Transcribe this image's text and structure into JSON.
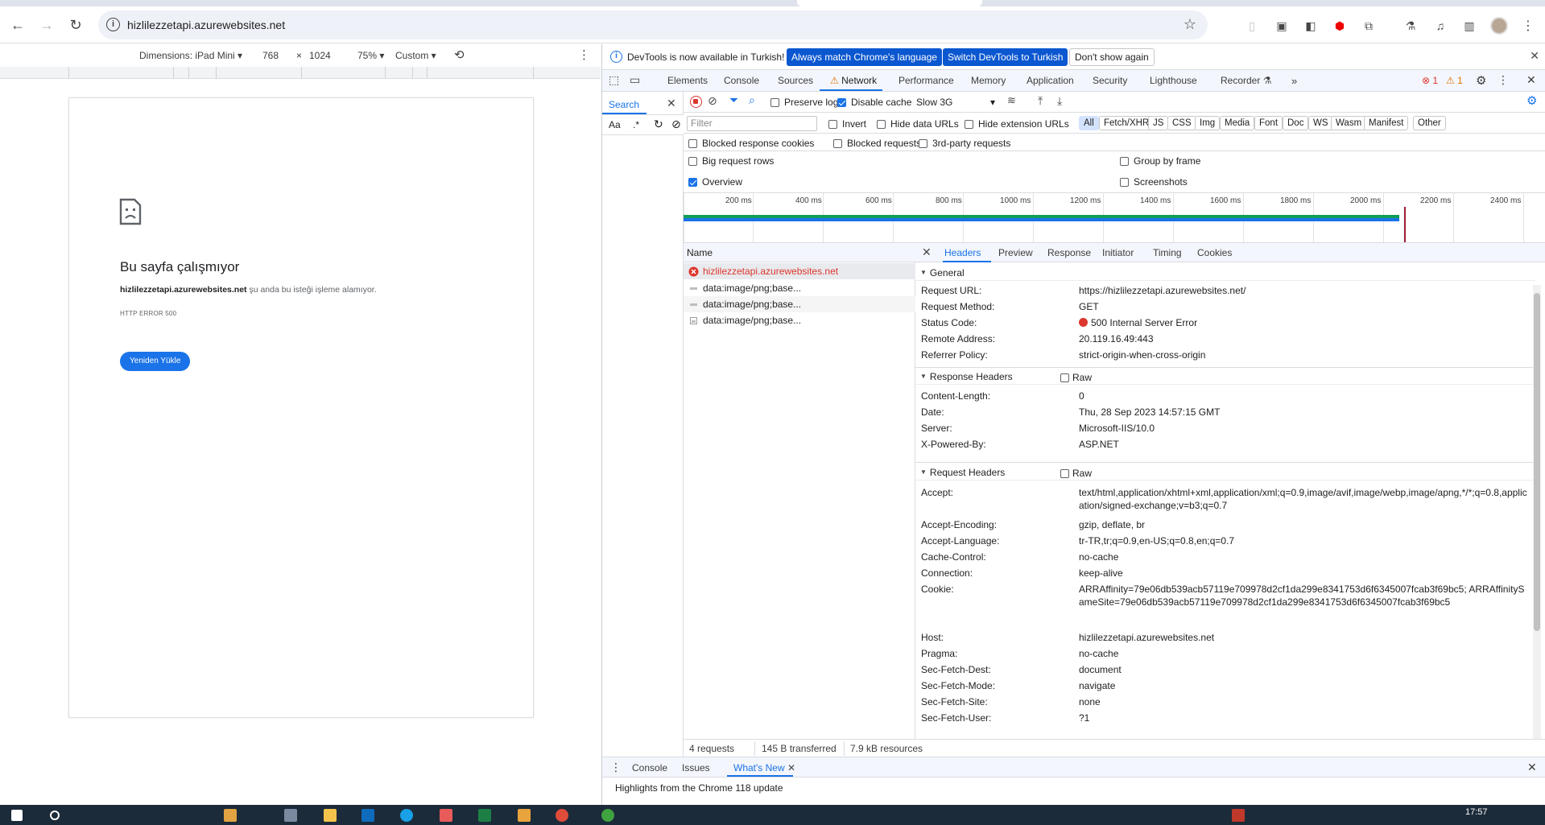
{
  "browser": {
    "url": "hizlilezzetapi.azurewebsites.net"
  },
  "device_toolbar": {
    "dimensions_label": "Dimensions: iPad Mini",
    "width": "768",
    "times": "×",
    "height": "1024",
    "zoom": "75%",
    "throttle": "Custom"
  },
  "error_page": {
    "title": "Bu sayfa çalışmıyor",
    "host": "hizlilezzetapi.azurewebsites.net",
    "desc_rest": " şu anda bu isteği işleme alamıyor.",
    "code": "HTTP ERROR 500",
    "reload_label": "Yeniden Yükle"
  },
  "infobar": {
    "message": "DevTools is now available in Turkish!",
    "btn_match": "Always match Chrome's language",
    "btn_switch": "Switch DevTools to Turkish",
    "btn_dismiss": "Don't show again"
  },
  "panel_tabs": [
    "Elements",
    "Console",
    "Sources",
    "Network",
    "Performance",
    "Memory",
    "Application",
    "Security",
    "Lighthouse",
    "Recorder"
  ],
  "issues": {
    "errors": "1",
    "warnings": "1"
  },
  "search_pane": {
    "tab": "Search",
    "match_case": "Aa",
    "regex": ".*"
  },
  "net_toolbar": {
    "preserve_log": "Preserve log",
    "disable_cache": "Disable cache",
    "throttling": "Slow 3G"
  },
  "filter_bar": {
    "placeholder": "Filter",
    "invert": "Invert",
    "hide_data_urls": "Hide data URLs",
    "hide_ext_urls": "Hide extension URLs",
    "types": [
      "All",
      "Fetch/XHR",
      "JS",
      "CSS",
      "Img",
      "Media",
      "Font",
      "Doc",
      "WS",
      "Wasm",
      "Manifest",
      "Other"
    ]
  },
  "options": {
    "blocked_cookies": "Blocked response cookies",
    "blocked_requests": "Blocked requests",
    "third_party": "3rd-party requests",
    "big_rows": "Big request rows",
    "group_by_frame": "Group by frame",
    "overview": "Overview",
    "screenshots": "Screenshots"
  },
  "overview_ticks": [
    "200 ms",
    "400 ms",
    "600 ms",
    "800 ms",
    "1000 ms",
    "1200 ms",
    "1400 ms",
    "1600 ms",
    "1800 ms",
    "2000 ms",
    "2200 ms",
    "2400 ms"
  ],
  "request_list": {
    "header": "Name",
    "rows": [
      {
        "name": "hizlilezzetapi.azurewebsites.net",
        "status": "error"
      },
      {
        "name": "data:image/png;base...",
        "status": "ok"
      },
      {
        "name": "data:image/png;base...",
        "status": "ok"
      },
      {
        "name": "data:image/png;base...",
        "status": "ok"
      }
    ]
  },
  "footer": {
    "requests": "4 requests",
    "transferred": "145 B transferred",
    "resources": "7.9 kB resources"
  },
  "detail_tabs": [
    "Headers",
    "Preview",
    "Response",
    "Initiator",
    "Timing",
    "Cookies"
  ],
  "general": {
    "title": "General",
    "rows": [
      {
        "k": "Request URL:",
        "v": "https://hizlilezzetapi.azurewebsites.net/"
      },
      {
        "k": "Request Method:",
        "v": "GET"
      },
      {
        "k": "Status Code:",
        "v": "500 Internal Server Error"
      },
      {
        "k": "Remote Address:",
        "v": "20.119.16.49:443"
      },
      {
        "k": "Referrer Policy:",
        "v": "strict-origin-when-cross-origin"
      }
    ]
  },
  "response_headers": {
    "title": "Response Headers",
    "raw": "Raw",
    "rows": [
      {
        "k": "Content-Length:",
        "v": "0"
      },
      {
        "k": "Date:",
        "v": "Thu, 28 Sep 2023 14:57:15 GMT"
      },
      {
        "k": "Server:",
        "v": "Microsoft-IIS/10.0"
      },
      {
        "k": "X-Powered-By:",
        "v": "ASP.NET"
      }
    ]
  },
  "request_headers": {
    "title": "Request Headers",
    "raw": "Raw",
    "rows": [
      {
        "k": "Accept:",
        "v": "text/html,application/xhtml+xml,application/xml;q=0.9,image/avif,image/webp,image/apng,*/*;q=0.8,application/signed-exchange;v=b3;q=0.7"
      },
      {
        "k": "Accept-Encoding:",
        "v": "gzip, deflate, br"
      },
      {
        "k": "Accept-Language:",
        "v": "tr-TR,tr;q=0.9,en-US;q=0.8,en;q=0.7"
      },
      {
        "k": "Cache-Control:",
        "v": "no-cache"
      },
      {
        "k": "Connection:",
        "v": "keep-alive"
      },
      {
        "k": "Cookie:",
        "v": "ARRAffinity=79e06db539acb57119e709978d2cf1da299e8341753d6f6345007fcab3f69bc5; ARRAffinitySameSite=79e06db539acb57119e709978d2cf1da299e8341753d6f6345007fcab3f69bc5"
      },
      {
        "k": "Host:",
        "v": "hizlilezzetapi.azurewebsites.net"
      },
      {
        "k": "Pragma:",
        "v": "no-cache"
      },
      {
        "k": "Sec-Fetch-Dest:",
        "v": "document"
      },
      {
        "k": "Sec-Fetch-Mode:",
        "v": "navigate"
      },
      {
        "k": "Sec-Fetch-Site:",
        "v": "none"
      },
      {
        "k": "Sec-Fetch-User:",
        "v": "?1"
      }
    ]
  },
  "drawer": {
    "tabs": [
      "Console",
      "Issues",
      "What's New"
    ],
    "message": "Highlights from the Chrome 118 update"
  },
  "taskbar": {
    "time": "17:57"
  },
  "colors": {
    "accent": "#1a73e8",
    "error": "#dc362e",
    "primary_button": "#0b57d0"
  }
}
